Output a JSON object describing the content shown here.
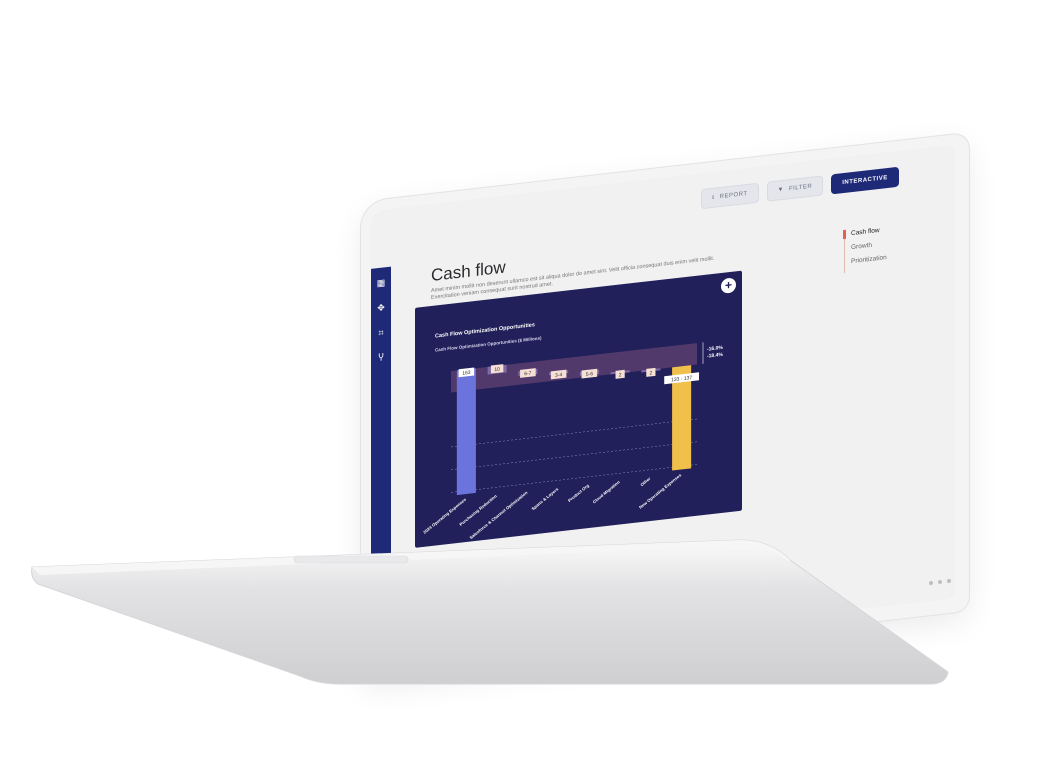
{
  "toolbar": {
    "report_label": "REPORT",
    "filter_label": "FILTER",
    "interactive_label": "INTERACTIVE"
  },
  "page": {
    "title": "Cash flow",
    "description": "Amet minim mollit non deserunt ullamco est sit aliqua dolor do amet sint. Velit officia consequat duis enim velit mollit. Exercitation veniam consequat sunt nostrud amet."
  },
  "right_nav": {
    "items": [
      {
        "label": "Cash flow"
      },
      {
        "label": "Growth"
      },
      {
        "label": "Prioritization"
      }
    ]
  },
  "sidebar": {
    "icons": [
      "dashboard-icon",
      "target-icon",
      "frame-icon",
      "branch-icon"
    ]
  },
  "card": {
    "title": "Cash Flow Optimization Opportunities",
    "subtitle": "Cash Flow Optimization Opportunities ($ Millions)"
  },
  "chart_data": {
    "type": "bar",
    "title": "Cash Flow Optimization Opportunities",
    "subtitle": "Cash Flow Optimization Opportunities ($ Millions)",
    "categories": [
      "2024 Operating Expenses",
      "Purchasing Reduction",
      "Salesforce & Channel Optimization",
      "Spans & Layers",
      "Product Org",
      "Cloud Migration",
      "Other",
      "New Operating Expenses"
    ],
    "labels": [
      "163",
      "10",
      "6-7",
      "3-4",
      "5-6",
      "2",
      "2",
      "133 - 137"
    ],
    "values": [
      163,
      10,
      6.5,
      3.5,
      5.5,
      2,
      2,
      135
    ],
    "range_labels": [
      "-16.0%",
      "-18.4%"
    ],
    "colors": {
      "start": "#6b73dc",
      "steps": "#7d6aa6",
      "end": "#f0c04a",
      "band": "#5a3e6e"
    }
  }
}
